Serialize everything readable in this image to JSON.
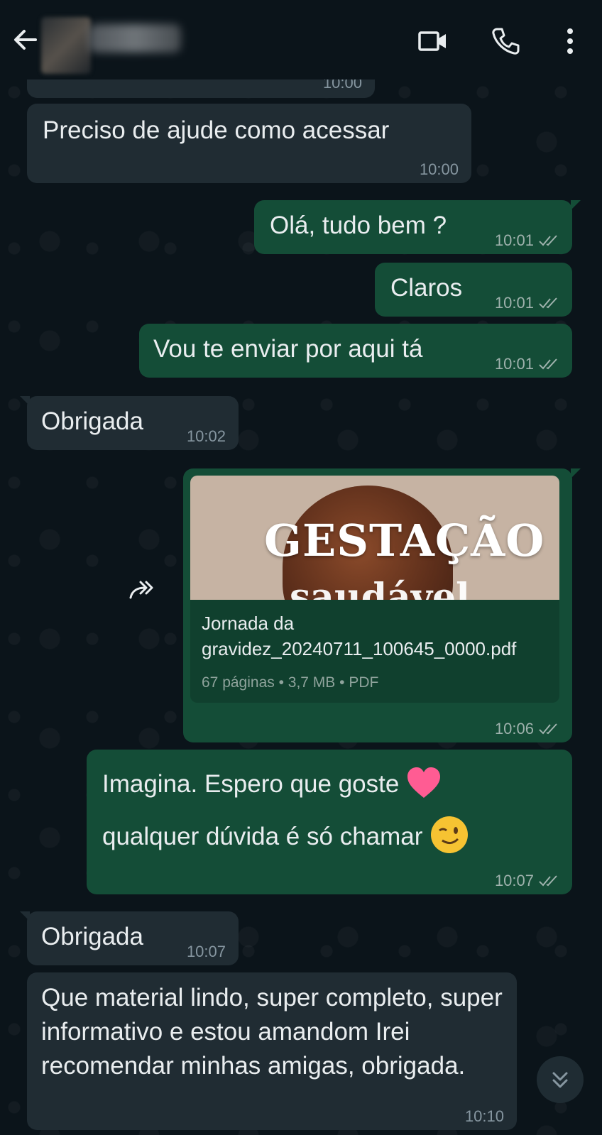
{
  "header": {
    "contact_name": "",
    "icons": [
      "arrow-back-icon",
      "video-call-icon",
      "voice-call-icon",
      "more-vert-icon"
    ]
  },
  "colors": {
    "background": "#0b141a",
    "incoming_bubble": "#202c33",
    "outgoing_bubble": "#144d37"
  },
  "messages": [
    {
      "dir": "in",
      "time_top_partial": "10:00"
    },
    {
      "dir": "in",
      "text": "Preciso de ajude como acessar",
      "time": "10:00"
    },
    {
      "dir": "out",
      "text": "Olá, tudo bem ?",
      "time": "10:01"
    },
    {
      "dir": "out",
      "text": "Claros",
      "time": "10:01"
    },
    {
      "dir": "out",
      "text": "Vou te enviar por aqui tá",
      "time": "10:01"
    },
    {
      "dir": "in",
      "text": "Obrigada",
      "time": "10:02"
    },
    {
      "dir": "out",
      "document": {
        "cover_title": "GESTAÇÃO",
        "cover_subtitle": "saudável",
        "filename": "Jornada da gravidez_20240711_100645_0000.pdf",
        "info": "67 páginas • 3,7 MB • PDF"
      },
      "time": "10:06"
    },
    {
      "dir": "out",
      "text_line1": "Imagina. Espero que goste",
      "text_line2": "qualquer dúvida é só chamar",
      "time": "10:07"
    },
    {
      "dir": "in",
      "text": "Obrigada",
      "time": "10:07"
    },
    {
      "dir": "in",
      "text": "Que material lindo, super completo, super informativo e estou amandom Irei recomendar minhas amigas, obrigada.",
      "time": "10:10"
    }
  ]
}
